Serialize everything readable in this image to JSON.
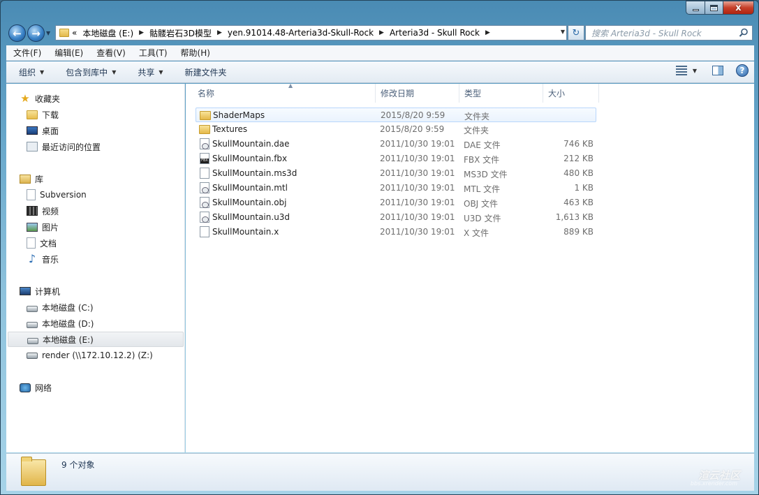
{
  "window": {
    "caption_buttons": {
      "minimize": "",
      "maximize": "",
      "close": "x"
    }
  },
  "navigation": {
    "back_glyph": "←",
    "forward_glyph": "→",
    "breadcrumbs": [
      "«",
      "本地磁盘 (E:)",
      "骷髅岩石3D模型",
      "yen.91014.48-Arteria3d-Skull-Rock",
      "Arteria3d - Skull Rock"
    ],
    "refresh_glyph": "↻",
    "search_placeholder": "搜索 Arteria3d - Skull Rock"
  },
  "menubar": [
    "文件(F)",
    "编辑(E)",
    "查看(V)",
    "工具(T)",
    "帮助(H)"
  ],
  "commandbar": {
    "organize": "组织",
    "include_in_library": "包含到库中",
    "share": "共享",
    "new_folder": "新建文件夹",
    "help_glyph": "?"
  },
  "navpane": {
    "favorites": {
      "label": "收藏夹",
      "items": [
        "下载",
        "桌面",
        "最近访问的位置"
      ]
    },
    "libraries": {
      "label": "库",
      "items": [
        "Subversion",
        "视频",
        "图片",
        "文档",
        "音乐"
      ]
    },
    "computer": {
      "label": "计算机",
      "items": [
        "本地磁盘 (C:)",
        "本地磁盘 (D:)",
        "本地磁盘 (E:)",
        "render (\\\\172.10.12.2) (Z:)"
      ]
    },
    "network": {
      "label": "网络"
    }
  },
  "columns": {
    "name": "名称",
    "date": "修改日期",
    "type": "类型",
    "size": "大小"
  },
  "files": [
    {
      "name": "ShaderMaps",
      "date": "2015/8/20 9:59",
      "type": "文件夹",
      "size": "",
      "icon": "folder-icon"
    },
    {
      "name": "Textures",
      "date": "2015/8/20 9:59",
      "type": "文件夹",
      "size": "",
      "icon": "folder-icon"
    },
    {
      "name": "SkullMountain.dae",
      "date": "2011/10/30 19:01",
      "type": "DAE 文件",
      "size": "746 KB",
      "icon": "image-file-icon"
    },
    {
      "name": "SkullMountain.fbx",
      "date": "2011/10/30 19:01",
      "type": "FBX 文件",
      "size": "212 KB",
      "icon": "fbx-file-icon"
    },
    {
      "name": "SkullMountain.ms3d",
      "date": "2011/10/30 19:01",
      "type": "MS3D 文件",
      "size": "480 KB",
      "icon": "blank-file-icon"
    },
    {
      "name": "SkullMountain.mtl",
      "date": "2011/10/30 19:01",
      "type": "MTL 文件",
      "size": "1 KB",
      "icon": "image-file-icon"
    },
    {
      "name": "SkullMountain.obj",
      "date": "2011/10/30 19:01",
      "type": "OBJ 文件",
      "size": "463 KB",
      "icon": "image-file-icon"
    },
    {
      "name": "SkullMountain.u3d",
      "date": "2011/10/30 19:01",
      "type": "U3D 文件",
      "size": "1,613 KB",
      "icon": "image-file-icon"
    },
    {
      "name": "SkullMountain.x",
      "date": "2011/10/30 19:01",
      "type": "X 文件",
      "size": "889 KB",
      "icon": "blank-file-icon"
    }
  ],
  "status": {
    "item_count": "9 个对象"
  },
  "watermark": {
    "main": "渲云社区",
    "sub": "bbs.xrender.com"
  },
  "colors": {
    "accent": "#3a83c8",
    "selection_border": "#b8d6fb",
    "close_red": "#c7402a"
  }
}
